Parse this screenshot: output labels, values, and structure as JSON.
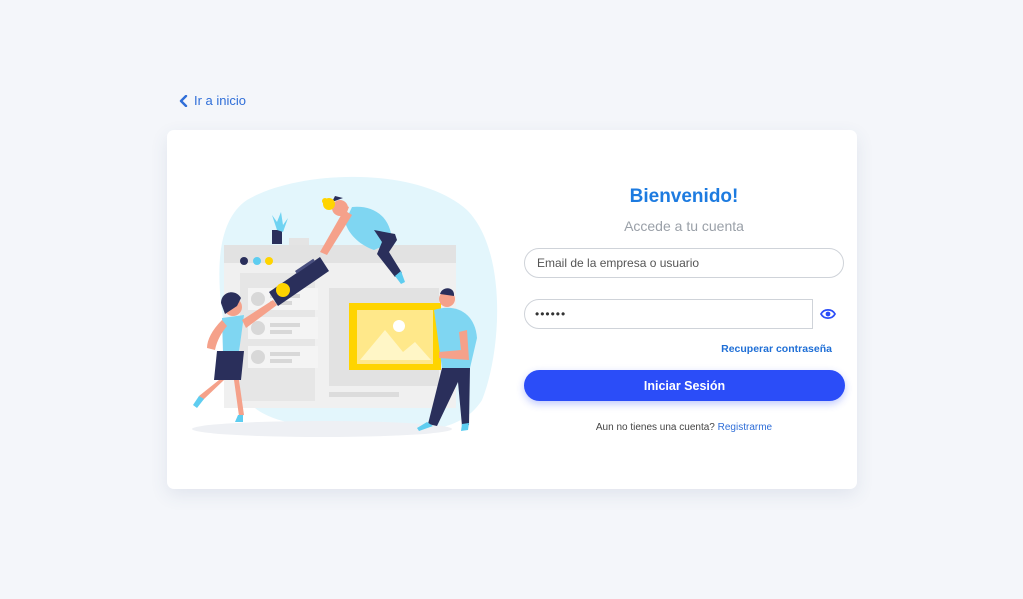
{
  "nav": {
    "back_label": "Ir a inicio"
  },
  "login": {
    "title": "Bienvenido!",
    "subtitle": "Accede a tu cuenta",
    "email_placeholder": "Email de la empresa o usuario",
    "password_value": "••••••",
    "recover_label": "Recuperar contraseña",
    "submit_label": "Iniciar Sesión",
    "register_prompt": "Aun no tienes una cuenta?",
    "register_link": "Registrarme"
  },
  "colors": {
    "background": "#f4f6fa",
    "accent": "#1d7be0",
    "button": "#2b4df8",
    "illustration_blob": "#e3f6fc",
    "illustration_people": "#7fd6f2",
    "illustration_frame": "#ffd400"
  },
  "icons": {
    "back": "chevron-left-icon",
    "password_toggle": "eye-icon"
  }
}
